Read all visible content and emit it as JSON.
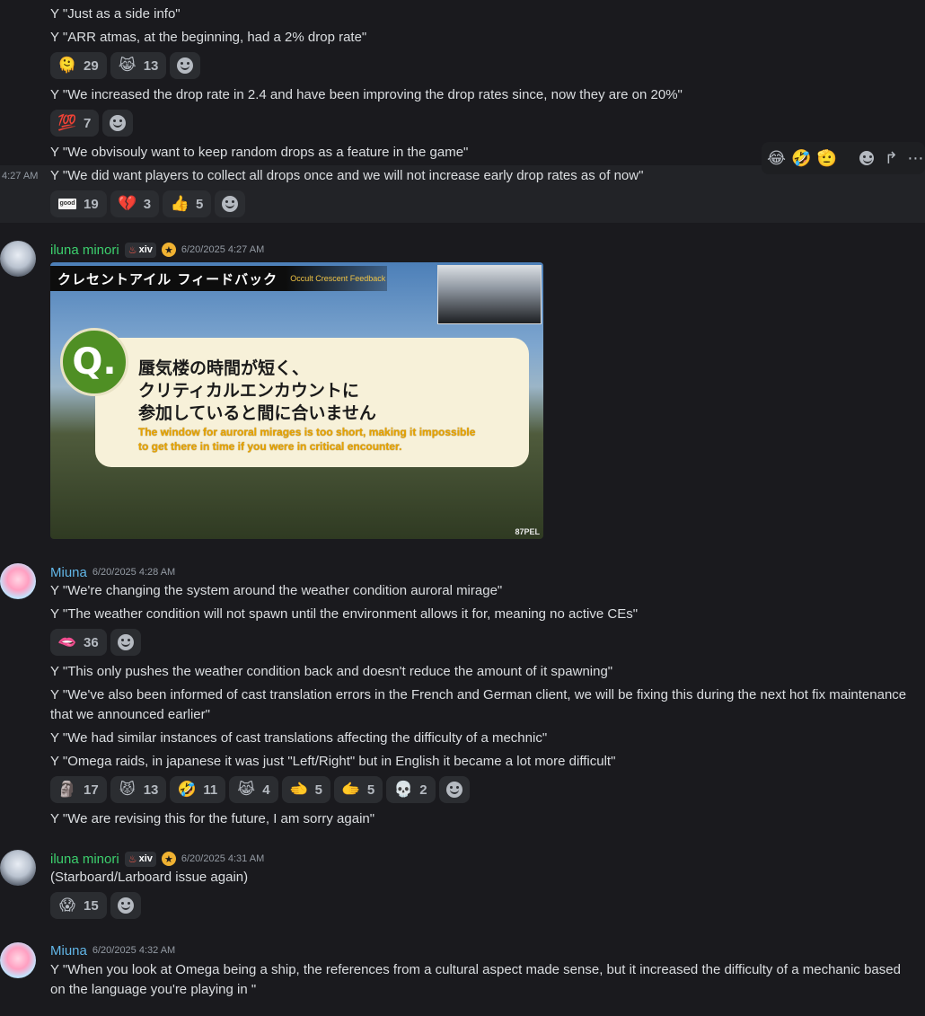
{
  "top_block": {
    "lines": [
      "Y \"Just as a side info\"",
      "Y \"ARR atmas, at the beginning, had a 2% drop rate\""
    ],
    "reactions1": [
      {
        "icon": "🫠",
        "count": "29"
      },
      {
        "icon": "😹",
        "count": "13"
      }
    ],
    "line3": "Y \"We increased the drop rate in 2.4 and have been improving the drop rates since, now they are on 20%\"",
    "reactions2": [
      {
        "icon": "💯",
        "count": "7"
      }
    ],
    "line4": "Y \"We obvisouly want to keep random drops as a feature in the game\"",
    "hover_time": "4:27 AM",
    "line5": "Y \"We did want players to collect all drops once and we will not increase early drop rates as of now\"",
    "reactions3": [
      {
        "icon": "good",
        "count": "19"
      },
      {
        "icon": "💔",
        "count": "3"
      },
      {
        "icon": "👍",
        "count": "5"
      }
    ]
  },
  "toolbar": {
    "items": [
      "😂",
      "🤣",
      "🫡",
      "☻",
      "↱",
      "⋯"
    ]
  },
  "msg_iluna1": {
    "username": "iluna minori",
    "tag": "xiv",
    "timestamp": "6/20/2025 4:27 AM",
    "image": {
      "jp_title": "クレセントアイル フィードバック",
      "en_title": "Occult Crescent Feedback",
      "q_label": "Q.",
      "jp_line1": "蜃気楼の時間が短く、",
      "jp_line2": "クリティカルエンカウントに",
      "jp_line3": "参加していると間に合いません",
      "en_line1": "The window for auroral mirages is too short, making it impossible",
      "en_line2": "to get there in time if you were in critical encounter.",
      "logo": "87PEL"
    }
  },
  "msg_miuna1": {
    "username": "Miuna",
    "timestamp": "6/20/2025 4:28 AM",
    "line1": "Y \"We're changing the system around the weather condition auroral mirage\"",
    "line2": "Y \"The weather condition will not spawn until the environment allows it for, meaning no active CEs\"",
    "reactions1": [
      {
        "icon": "🫦",
        "count": "36"
      }
    ],
    "line3": "Y \"This only pushes the weather condition back and doesn't reduce the amount of it spawning\"",
    "line4": "Y \"We've also been informed of cast translation errors in the French and German client, we will be fixing this during the next hot fix maintenance that we announced earlier\"",
    "line5": "Y \"We had similar instances of cast translations affecting the difficulty of a mechnic\"",
    "line6": "Y \"Omega raids, in japanese it was just \"Left/Right\" but in English it became a lot more difficult\"",
    "reactions2": [
      {
        "icon": "🗿",
        "count": "17"
      },
      {
        "icon": "😾",
        "count": "13"
      },
      {
        "icon": "🤣",
        "count": "11"
      },
      {
        "icon": "😹",
        "count": "4"
      },
      {
        "icon": "🫲",
        "count": "5"
      },
      {
        "icon": "🫱",
        "count": "5"
      },
      {
        "icon": "💀",
        "count": "2"
      }
    ],
    "line7": "Y \"We are revising this for the future, I am sorry again\""
  },
  "msg_iluna2": {
    "username": "iluna minori",
    "tag": "xiv",
    "timestamp": "6/20/2025 4:31 AM",
    "line1": "(Starboard/Larboard issue again)",
    "reactions1": [
      {
        "icon": "😱",
        "count": "15"
      }
    ]
  },
  "msg_miuna2": {
    "username": "Miuna",
    "timestamp": "6/20/2025 4:32 AM",
    "line1": "Y \"When you look at Omega being a ship, the references from a cultural aspect made sense, but it increased the difficulty of a mechanic based on the language you're playing in \""
  }
}
